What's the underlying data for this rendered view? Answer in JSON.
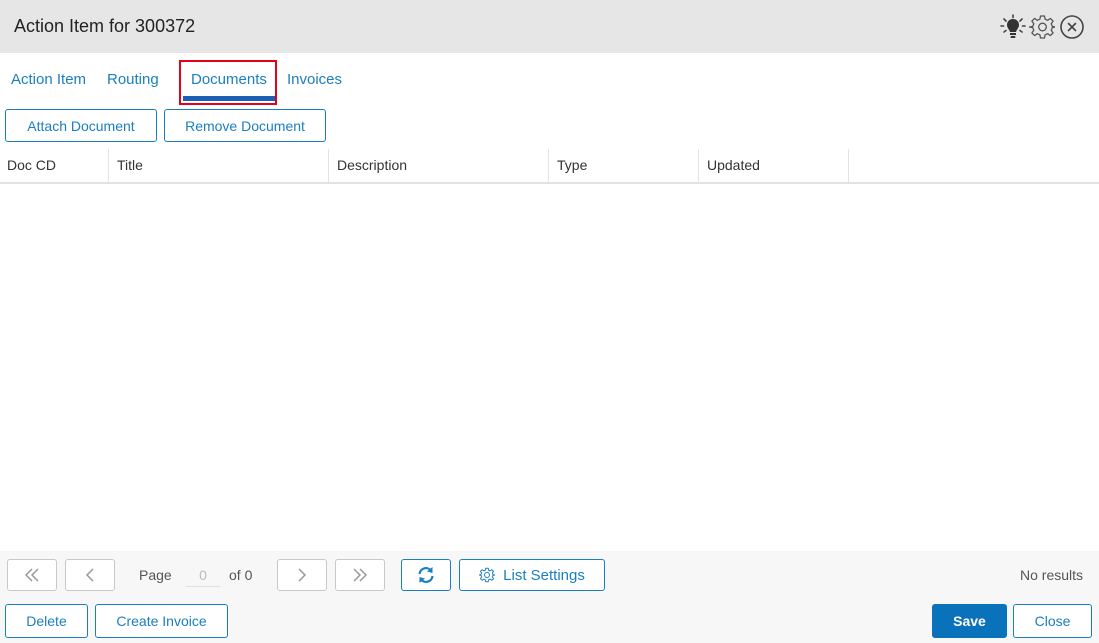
{
  "header": {
    "title": "Action Item for 300372",
    "icons": [
      "lightbulb-icon",
      "gear-icon",
      "close-circle-icon"
    ]
  },
  "tabs": [
    {
      "label": "Action Item"
    },
    {
      "label": "Routing"
    },
    {
      "label": "Documents",
      "active": true
    },
    {
      "label": "Invoices"
    }
  ],
  "toolbar": {
    "attach_label": "Attach Document",
    "remove_label": "Remove Document"
  },
  "grid": {
    "columns": [
      "Doc CD",
      "Title",
      "Description",
      "Type",
      "Updated"
    ],
    "rows": []
  },
  "pager": {
    "page_label": "Page",
    "page_value": "0",
    "of_label": "of 0",
    "list_settings_label": "List Settings",
    "results_text": "No results"
  },
  "footer": {
    "delete_label": "Delete",
    "create_invoice_label": "Create Invoice",
    "save_label": "Save",
    "close_label": "Close"
  },
  "colors": {
    "accent": "#1a7fc1",
    "primary_button": "#0a71bb",
    "tab_underline": "#1d5fb3",
    "highlight_box": "#e3001b",
    "header_bg": "#e6e6e6"
  }
}
